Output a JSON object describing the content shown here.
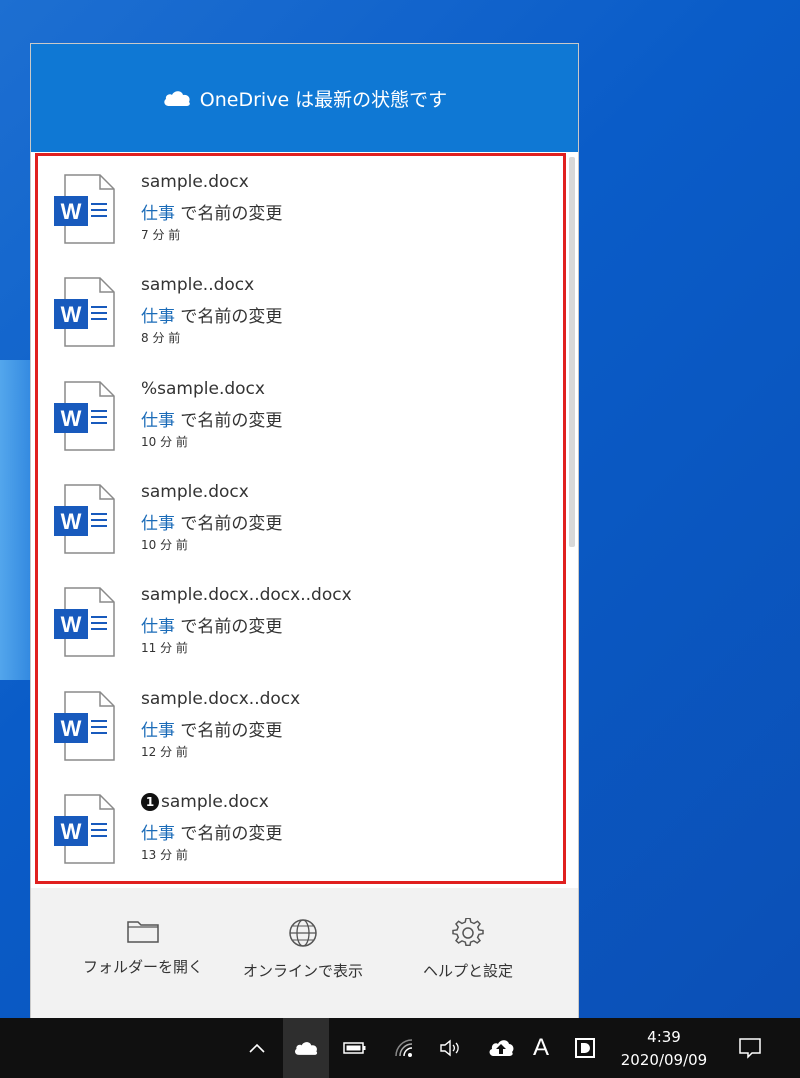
{
  "header": {
    "title": "OneDrive は最新の状態です",
    "icon": "cloud-icon"
  },
  "files": [
    {
      "name": "sample.docx",
      "folder": "仕事",
      "action": " で名前の変更",
      "time": "7 分 前",
      "badge": ""
    },
    {
      "name": "sample..docx",
      "folder": "仕事",
      "action": " で名前の変更",
      "time": "8 分 前",
      "badge": ""
    },
    {
      "name": "%sample.docx",
      "folder": "仕事",
      "action": " で名前の変更",
      "time": "10 分 前",
      "badge": ""
    },
    {
      "name": "sample.docx",
      "folder": "仕事",
      "action": " で名前の変更",
      "time": "10 分 前",
      "badge": ""
    },
    {
      "name": "sample.docx..docx..docx",
      "folder": "仕事",
      "action": " で名前の変更",
      "time": "11 分 前",
      "badge": ""
    },
    {
      "name": "sample.docx..docx",
      "folder": "仕事",
      "action": " で名前の変更",
      "time": "12 分 前",
      "badge": ""
    },
    {
      "name": "sample.docx",
      "folder": "仕事",
      "action": " で名前の変更",
      "time": "13 分 前",
      "badge": "1"
    }
  ],
  "footer": {
    "open_folder": "フォルダーを開く",
    "view_online": "オンラインで表示",
    "help_settings": "ヘルプと設定"
  },
  "taskbar": {
    "ime_label": "A",
    "time": "4:39",
    "date": "2020/09/09"
  },
  "colors": {
    "header_bg": "#0f78d4",
    "highlight_border": "#e0201f",
    "folder_link": "#1a6bb8",
    "word_blue": "#185abd"
  }
}
